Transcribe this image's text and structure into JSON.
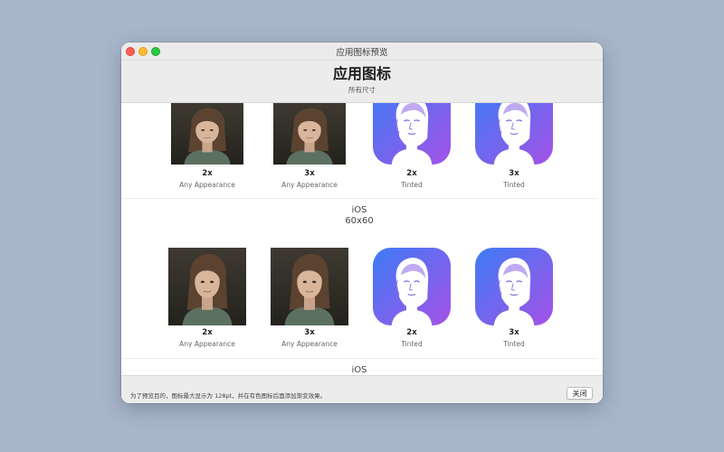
{
  "window": {
    "title": "应用图标预览"
  },
  "header": {
    "title": "应用图标",
    "subtitle": "所有尺寸"
  },
  "sections": [
    {
      "label_lines": [],
      "icons": [
        {
          "scale": "2x",
          "appearance": "Any Appearance",
          "style": "photo"
        },
        {
          "scale": "3x",
          "appearance": "Any Appearance",
          "style": "photo"
        },
        {
          "scale": "2x",
          "appearance": "Tinted",
          "style": "tinted"
        },
        {
          "scale": "3x",
          "appearance": "Tinted",
          "style": "tinted"
        }
      ]
    },
    {
      "label_lines": [
        "iOS",
        "60x60"
      ],
      "icons": [
        {
          "scale": "2x",
          "appearance": "Any Appearance",
          "style": "photo"
        },
        {
          "scale": "3x",
          "appearance": "Any Appearance",
          "style": "photo"
        },
        {
          "scale": "2x",
          "appearance": "Tinted",
          "style": "tinted"
        },
        {
          "scale": "3x",
          "appearance": "Tinted",
          "style": "tinted"
        }
      ]
    },
    {
      "label_lines": [
        "iOS"
      ],
      "icons": []
    }
  ],
  "footer": {
    "note": "为了预览目的，图标最大显示为 128pt，并在有色图标后面添加渐变效果。",
    "close_label": "关闭"
  },
  "icon_names": {
    "photo": "portrait-photo-icon",
    "tinted": "tinted-face-icon"
  },
  "colors": {
    "desktop": "#a9b6ca",
    "tint_gradient_start": "#3d7bf6",
    "tint_gradient_end": "#a552e6"
  }
}
